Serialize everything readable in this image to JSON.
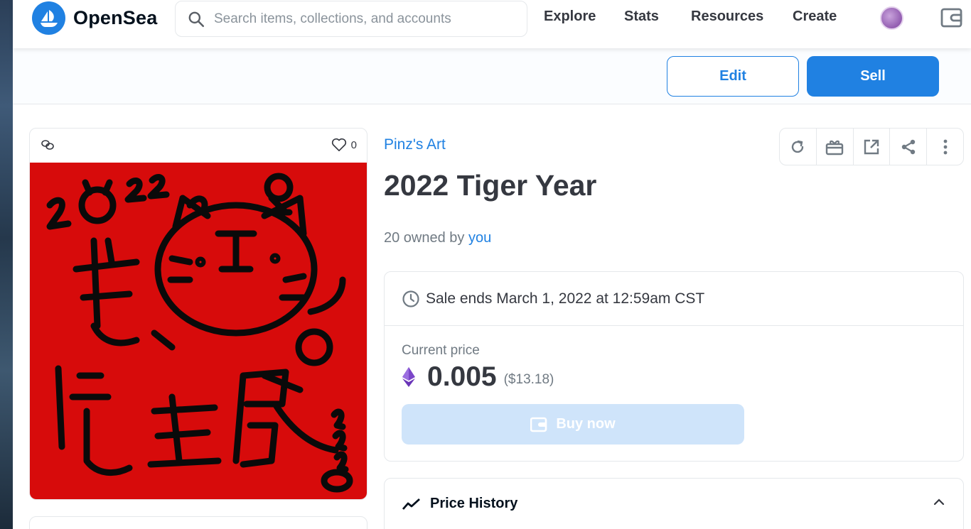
{
  "header": {
    "logo_text": "OpenSea",
    "search": {
      "placeholder": "Search items, collections, and accounts",
      "value": ""
    },
    "nav": [
      "Explore",
      "Stats",
      "Resources",
      "Create"
    ],
    "icons": [
      "search-icon",
      "avatar",
      "wallet-icon"
    ]
  },
  "actions": {
    "edit_label": "Edit",
    "sell_label": "Sell"
  },
  "asset": {
    "favorites_count": "0",
    "collection": "Pinz's Art",
    "title": "2022 Tiger Year",
    "owned_prefix": "20 owned by",
    "owner": "you"
  },
  "sale": {
    "ends_text": "Sale ends March 1, 2022 at 12:59am CST",
    "current_price_label": "Current price",
    "price": "0.005",
    "usd": "($13.18)",
    "buy_label": "Buy now"
  },
  "price_history": {
    "title": "Price History"
  },
  "colors": {
    "brand": "#2081e2",
    "artwork_bg": "#d70b0b",
    "buy_disabled": "#cfe4fa",
    "eth": "#7b46c9"
  }
}
